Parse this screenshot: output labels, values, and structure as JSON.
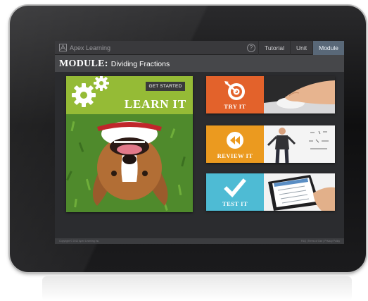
{
  "app": {
    "logo_text": "Apex Learning"
  },
  "nav": {
    "help_glyph": "?",
    "tabs": [
      {
        "label": "Tutorial",
        "active": false
      },
      {
        "label": "Unit",
        "active": false
      },
      {
        "label": "Module",
        "active": true
      }
    ]
  },
  "header": {
    "module_label": "MODULE:",
    "module_name": "Dividing Fractions"
  },
  "learn_card": {
    "button_label": "GET STARTED",
    "title": "LEARN IT",
    "color": "#95bb36"
  },
  "activity_cards": [
    {
      "label": "TRY IT",
      "icon": "target-arrow-icon",
      "color": "#e3622b"
    },
    {
      "label": "REVIEW IT",
      "icon": "rewind-icon",
      "color": "#eb9a1f"
    },
    {
      "label": "TEST IT",
      "icon": "checkmark-icon",
      "color": "#4ebbd4"
    }
  ],
  "footer": {
    "copyright": "Copyright © 2012 Apex Learning Inc.",
    "links": "FAQ | Terms of Use | Privacy Policy"
  },
  "colors": {
    "active_tab": "#596878",
    "screen_bg": "#2b2c2f",
    "title_bar": "#46474a"
  }
}
